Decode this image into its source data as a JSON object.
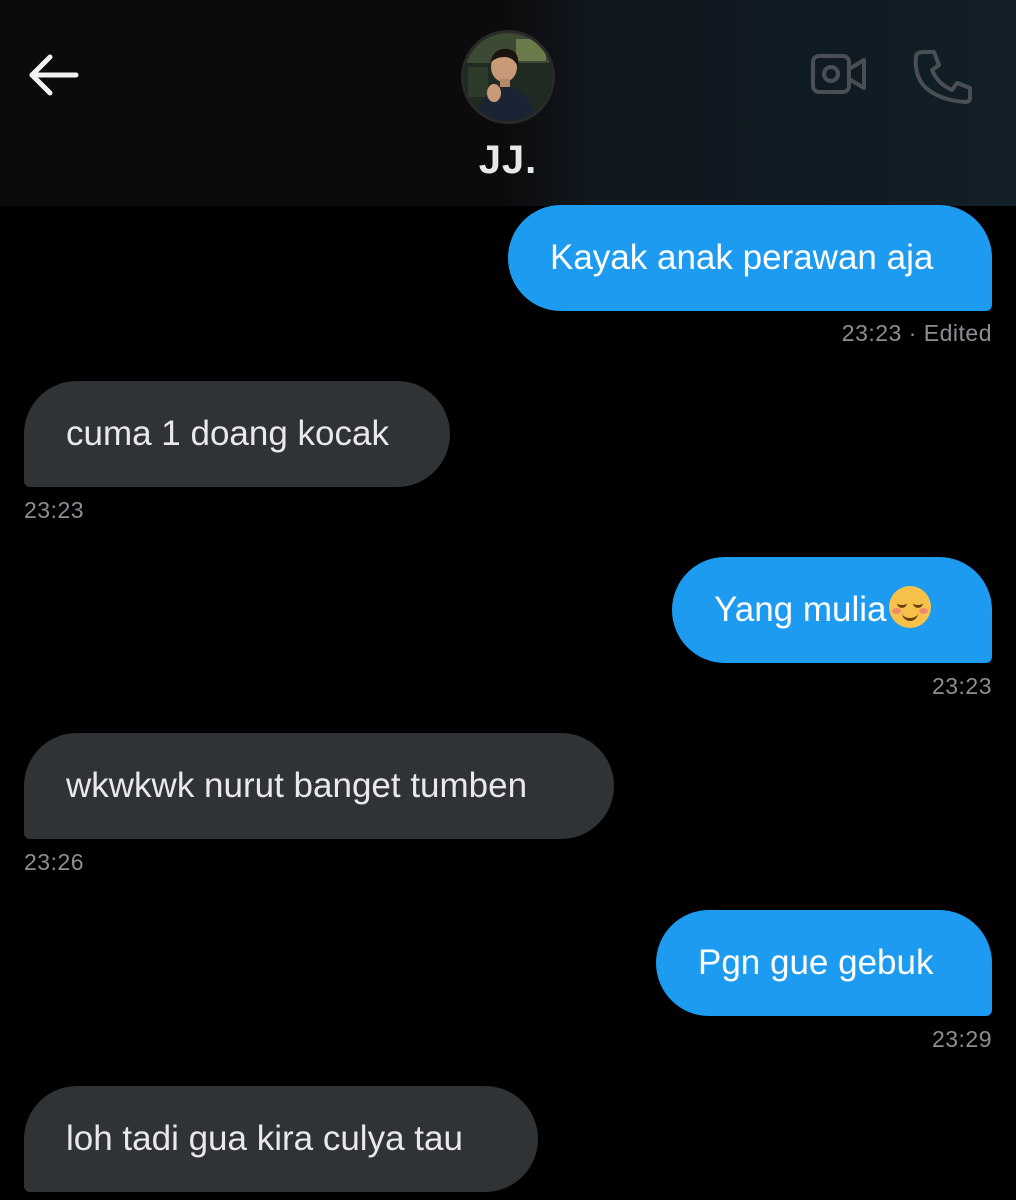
{
  "header": {
    "contact_name": "JJ.",
    "icons": {
      "back": "arrow-left-icon",
      "video": "video-camera-icon",
      "call": "phone-icon"
    }
  },
  "messages": [
    {
      "direction": "outgoing",
      "text": "Kayak anak perawan aja",
      "meta": "23:23 · Edited"
    },
    {
      "direction": "incoming",
      "text": "cuma 1 doang kocak",
      "meta": "23:23"
    },
    {
      "direction": "outgoing",
      "text": "Yang mulia",
      "emoji": "smiling-face-icon",
      "meta": "23:23"
    },
    {
      "direction": "incoming",
      "text": "wkwkwk nurut banget tumben",
      "meta": "23:26"
    },
    {
      "direction": "outgoing",
      "text": "Pgn gue gebuk",
      "meta": "23:29"
    },
    {
      "direction": "incoming",
      "text": "loh tadi gua kira culya tau"
    }
  ],
  "colors": {
    "background": "#000000",
    "header": "#0b0b0b",
    "outgoing_bubble": "#1d9bf0",
    "incoming_bubble": "#2f3336",
    "meta_text": "#8b8f94"
  }
}
